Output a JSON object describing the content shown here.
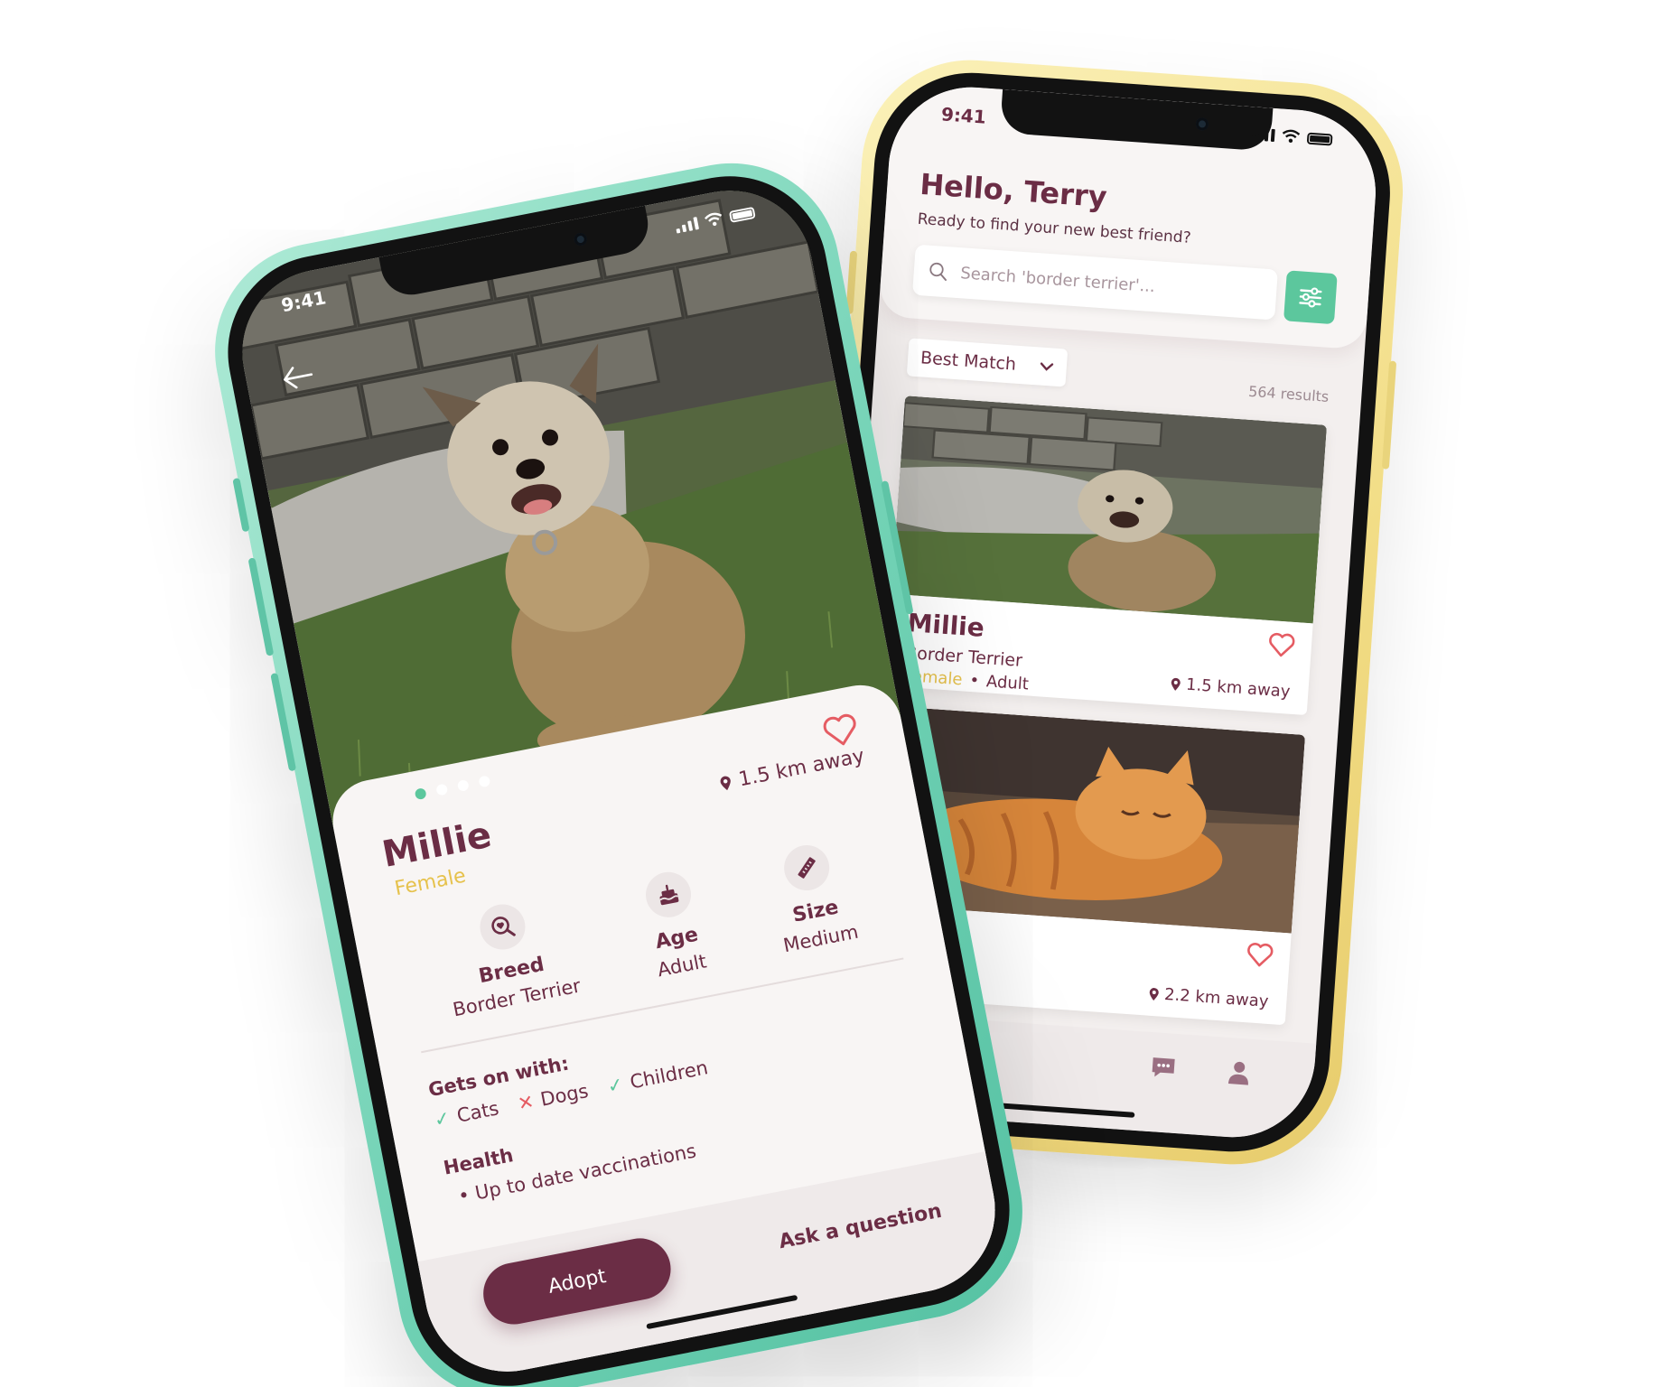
{
  "status_bar": {
    "time": "9:41"
  },
  "list_screen": {
    "greeting": "Hello, Terry",
    "subtitle": "Ready to find your new best friend?",
    "search": {
      "placeholder": "Search 'border terrier'...",
      "value": ""
    },
    "sort": {
      "selected": "Best Match"
    },
    "results_count": "564 results",
    "cards": [
      {
        "name": "Millie",
        "breed": "Border Terrier",
        "gender": "Female",
        "age": "Adult",
        "distance": "1.5 km away",
        "photo": "border-terrier-photo"
      },
      {
        "name": "",
        "breed": "",
        "gender": "",
        "age": "",
        "distance": "2.2 km away",
        "photo": "ginger-cat-photo"
      }
    ],
    "tab_bar": {
      "icons": [
        "chat-icon",
        "profile-icon"
      ]
    }
  },
  "detail_screen": {
    "name": "Millie",
    "gender": "Female",
    "distance": "1.5 km away",
    "photo_count": 4,
    "active_photo": 0,
    "attributes": [
      {
        "label": "Breed",
        "value": "Border Terrier",
        "icon": "breed-search-icon"
      },
      {
        "label": "Age",
        "value": "Adult",
        "icon": "birthday-cake-icon"
      },
      {
        "label": "Size",
        "value": "Medium",
        "icon": "ruler-icon"
      }
    ],
    "gets_on_with_title": "Gets on with:",
    "gets_on_with": [
      {
        "label": "Cats",
        "ok": true
      },
      {
        "label": "Dogs",
        "ok": false
      },
      {
        "label": "Children",
        "ok": true
      }
    ],
    "health_title": "Health",
    "health_items": [
      "Up to date vaccinations"
    ],
    "adopt_label": "Adopt",
    "ask_label": "Ask a question"
  },
  "colors": {
    "primary": "#6b2d45",
    "accent_green": "#5cc79d",
    "gender_yellow": "#e6c24d",
    "heart_red": "#e55c63",
    "back_phone_frame": "#f2dd86",
    "front_phone_frame": "#72d2b5"
  },
  "check_mark": "✓",
  "cross_mark": "✕",
  "bullet": "•"
}
